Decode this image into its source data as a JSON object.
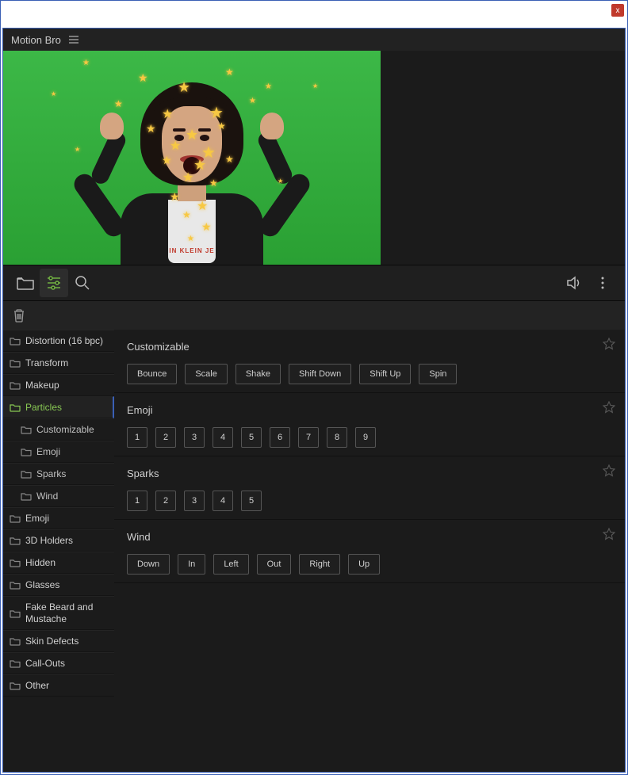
{
  "window": {
    "close_label": "x"
  },
  "titlebar": {
    "title": "Motion Bro"
  },
  "toolbar": {
    "folder": "folder-icon",
    "filter": "filter-icon",
    "search": "search-icon",
    "audio": "audio-icon",
    "more": "more-icon"
  },
  "sidebar": {
    "categories": [
      {
        "label": "Distortion (16 bpc)"
      },
      {
        "label": "Transform"
      },
      {
        "label": "Makeup"
      },
      {
        "label": "Particles",
        "active": true,
        "children": [
          {
            "label": "Customizable"
          },
          {
            "label": "Emoji"
          },
          {
            "label": "Sparks"
          },
          {
            "label": "Wind"
          }
        ]
      },
      {
        "label": "Emoji"
      },
      {
        "label": "3D Holders"
      },
      {
        "label": "Hidden"
      },
      {
        "label": "Glasses"
      },
      {
        "label": "Fake Beard and Mustache"
      },
      {
        "label": "Skin Defects"
      },
      {
        "label": "Call-Outs"
      },
      {
        "label": "Other"
      }
    ]
  },
  "sections": [
    {
      "title": "Customizable",
      "presets": [
        "Bounce",
        "Scale",
        "Shake",
        "Shift Down",
        "Shift Up",
        "Spin"
      ]
    },
    {
      "title": "Emoji",
      "presets": [
        "1",
        "2",
        "3",
        "4",
        "5",
        "6",
        "7",
        "8",
        "9"
      ],
      "numeric": true
    },
    {
      "title": "Sparks",
      "presets": [
        "1",
        "2",
        "3",
        "4",
        "5"
      ],
      "numeric": true
    },
    {
      "title": "Wind",
      "presets": [
        "Down",
        "In",
        "Left",
        "Out",
        "Right",
        "Up"
      ]
    }
  ],
  "preview": {
    "shirt_text": "IN KLEIN JE"
  }
}
